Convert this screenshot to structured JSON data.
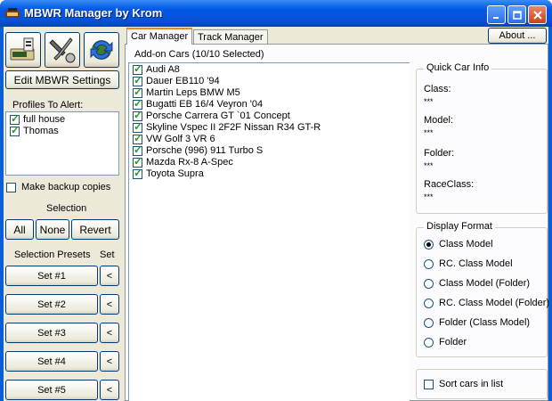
{
  "window": {
    "title": "MBWR Manager by Krom"
  },
  "toolbar": {
    "edit_settings_label": "Edit MBWR Settings"
  },
  "profiles": {
    "label": "Profiles To Alert:",
    "items": [
      {
        "label": "full house",
        "checked": true
      },
      {
        "label": "Thomas",
        "checked": true
      }
    ]
  },
  "backup": {
    "label": "Make backup copies",
    "checked": false
  },
  "selection": {
    "label": "Selection",
    "all_label": "All",
    "none_label": "None",
    "revert_label": "Revert"
  },
  "presets": {
    "label": "Selection Presets",
    "set_label": "Set",
    "items": [
      {
        "label": "Set #1",
        "arrow": "<"
      },
      {
        "label": "Set #2",
        "arrow": "<"
      },
      {
        "label": "Set #3",
        "arrow": "<"
      },
      {
        "label": "Set #4",
        "arrow": "<"
      },
      {
        "label": "Set #5",
        "arrow": "<"
      }
    ]
  },
  "tabs": [
    {
      "label": "Car Manager"
    },
    {
      "label": "Track Manager"
    }
  ],
  "about_label": "About ...",
  "cars": {
    "header": "Add-on Cars (10/10 Selected)",
    "items": [
      {
        "label": "Audi A8",
        "checked": true
      },
      {
        "label": "Dauer EB110 '94",
        "checked": true
      },
      {
        "label": "Martin Leps BMW M5",
        "checked": true
      },
      {
        "label": "Bugatti EB 16/4 Veyron '04",
        "checked": true
      },
      {
        "label": "Porsche Carrera GT `01 Concept",
        "checked": true
      },
      {
        "label": "Skyline Vspec II 2F2F Nissan R34 GT-R",
        "checked": true
      },
      {
        "label": "VW Golf 3 VR 6",
        "checked": true
      },
      {
        "label": "Porsche (996) 911 Turbo S",
        "checked": true
      },
      {
        "label": "Mazda Rx-8 A-Spec",
        "checked": true
      },
      {
        "label": "Toyota Supra",
        "checked": true
      }
    ]
  },
  "quick_info": {
    "label": "Quick Car Info",
    "fields": [
      {
        "label": "Class:",
        "value": "***"
      },
      {
        "label": "Model:",
        "value": "***"
      },
      {
        "label": "Folder:",
        "value": "***"
      },
      {
        "label": "RaceClass:",
        "value": "***"
      }
    ]
  },
  "display_format": {
    "label": "Display Format",
    "options": [
      {
        "label": "Class Model",
        "selected": true
      },
      {
        "label": "RC. Class Model",
        "selected": false
      },
      {
        "label": "Class Model (Folder)",
        "selected": false
      },
      {
        "label": "RC. Class Model (Folder)",
        "selected": false
      },
      {
        "label": "Folder (Class Model)",
        "selected": false
      },
      {
        "label": "Folder",
        "selected": false
      }
    ]
  },
  "sort": {
    "label": "Sort cars in list",
    "checked": false
  }
}
